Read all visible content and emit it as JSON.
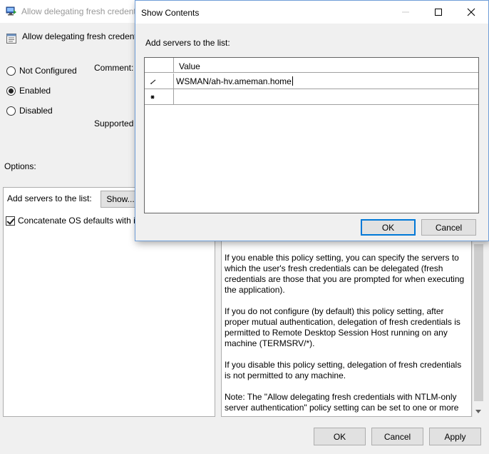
{
  "policy_window": {
    "title": "Allow delegating fresh credenti",
    "header_title": "Allow delegating fresh credent",
    "radio": [
      {
        "label": "Not Configured",
        "checked": false
      },
      {
        "label": "Enabled",
        "checked": true
      },
      {
        "label": "Disabled",
        "checked": false
      }
    ],
    "comment_label": "Comment:",
    "supported_label": "Supported",
    "options_label": "Options:",
    "add_servers_label": "Add servers to the list:",
    "show_button": "Show...",
    "concatenate_label": "Concatenate OS defaults with in",
    "concatenate_checked": true,
    "help_paragraphs": [
      "If you enable this policy setting, you can specify the servers to which the user's fresh credentials can be delegated (fresh credentials are those that you are prompted for when executing the application).",
      "If you do not configure (by default) this policy setting, after proper mutual authentication, delegation of fresh credentials is permitted to Remote Desktop Session Host running on any machine (TERMSRV/*).",
      "If you disable this policy setting, delegation of fresh credentials is not permitted to any machine.",
      "Note: The \"Allow delegating fresh credentials with NTLM-only server authentication\" policy setting can be set to one or more"
    ],
    "ok_button": "OK",
    "cancel_button": "Cancel",
    "apply_button": "Apply"
  },
  "show_contents": {
    "title": "Show Contents",
    "prompt": "Add servers to the list:",
    "column_header": "Value",
    "rows": [
      {
        "marker": "pencil-icon",
        "value": "WSMAN/ah-hv.ameman.home"
      },
      {
        "marker": "new-row-icon",
        "value": ""
      }
    ],
    "ok_button": "OK",
    "cancel_button": "Cancel"
  },
  "colors": {
    "window_bg": "#f0f0f0",
    "accent": "#0078d7",
    "dialog_border": "#6f9ed8"
  }
}
